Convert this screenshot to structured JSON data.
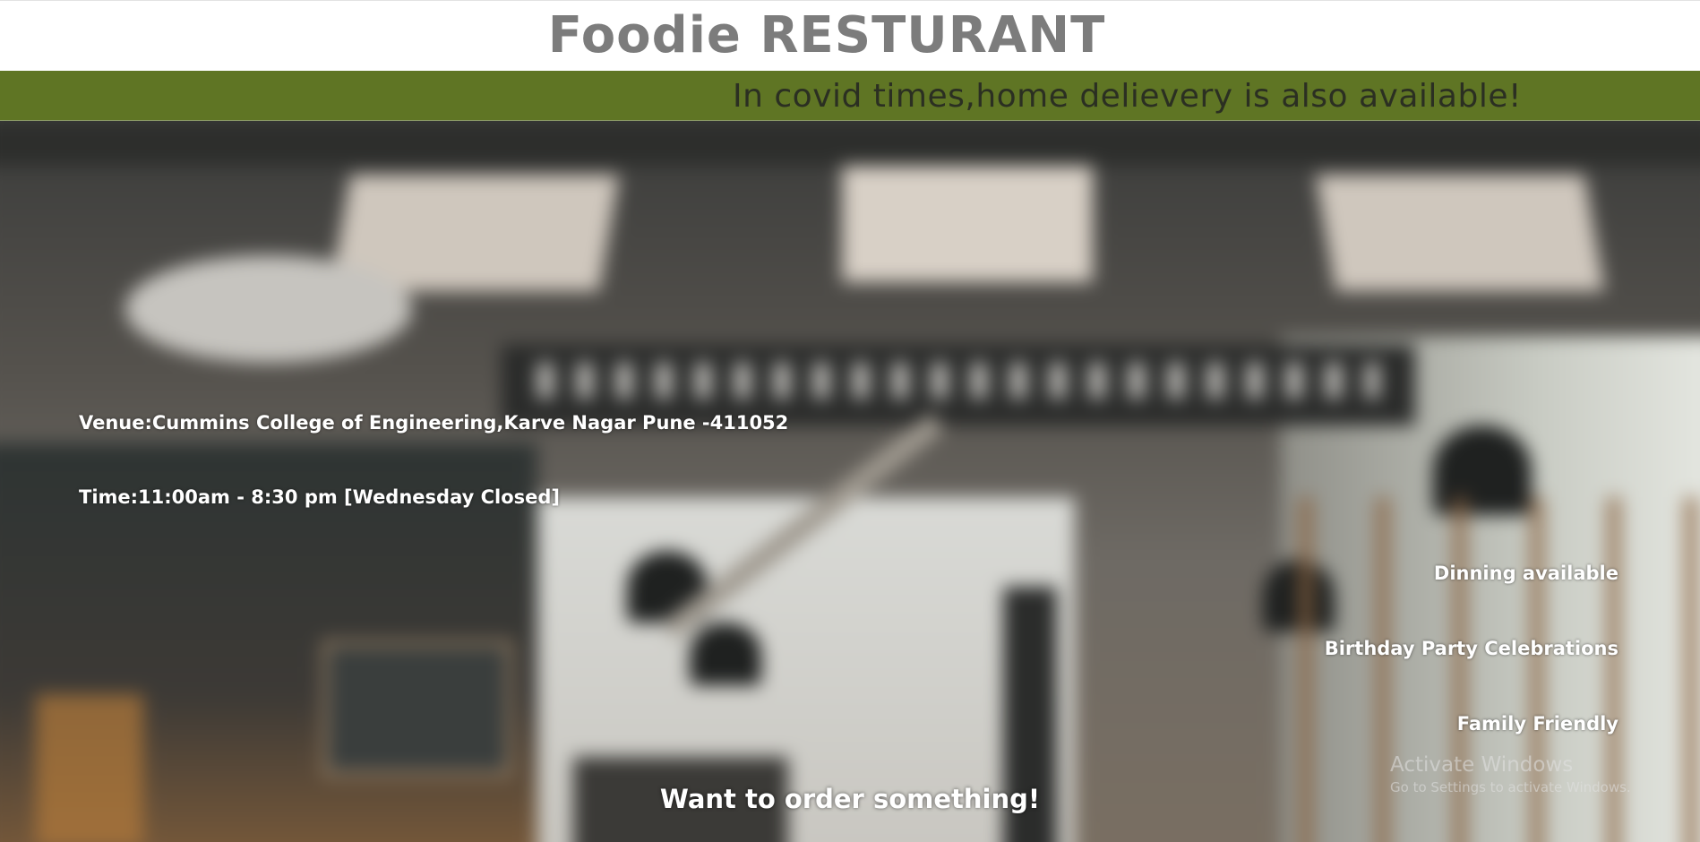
{
  "header": {
    "title": "Foodie RESTURANT"
  },
  "banner": {
    "text": "In covid times,home delievery is also available!",
    "color": "#5f7524"
  },
  "info": {
    "venue": "Venue:Cummins College of Engineering,Karve Nagar Pune -411052",
    "time": "Time:11:00am - 8:30 pm [Wednesday Closed]"
  },
  "features": [
    "Dinning available",
    "Birthday Party Celebrations",
    "Family Friendly"
  ],
  "cta": {
    "label": "Want to order something!"
  },
  "watermark": {
    "title": "Activate Windows",
    "subtitle": "Go to Settings to activate Windows."
  }
}
